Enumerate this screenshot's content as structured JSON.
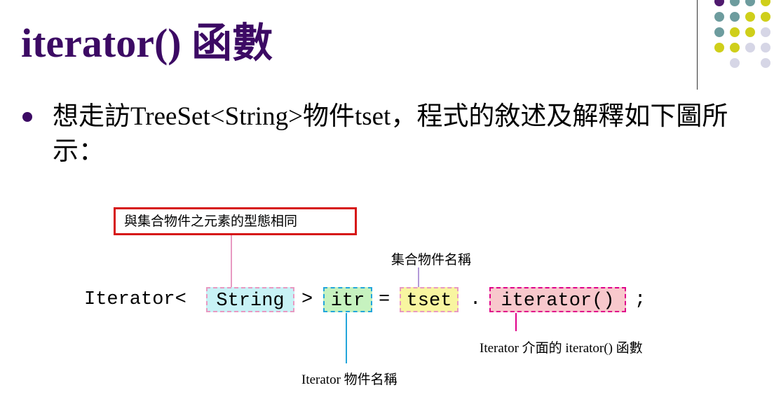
{
  "slide": {
    "title": "iterator() 函數",
    "bullet": "想走訪TreeSet<String>物件tset，程式的敘述及解釋如下圖所示："
  },
  "diagram": {
    "code": {
      "prefix": "Iterator<",
      "type": "String",
      "gt": ">",
      "var": "itr",
      "eq": "=",
      "obj": "tset",
      "dot": ".",
      "method": "iterator()",
      "semicolon": ";"
    },
    "labels": {
      "type_note": "與集合物件之元素的型態相同",
      "collection_name": "集合物件名稱",
      "iterator_var": "Iterator 物件名稱",
      "iterator_method": "Iterator 介面的 iterator() 函數"
    }
  },
  "colors": {
    "title": "#3c0a64",
    "string_fill": "#c8f2f6",
    "itr_fill": "#c6f2bf",
    "tset_fill": "#f8f5a0",
    "method_fill": "#f8c8cc",
    "red_border": "#d61515"
  }
}
